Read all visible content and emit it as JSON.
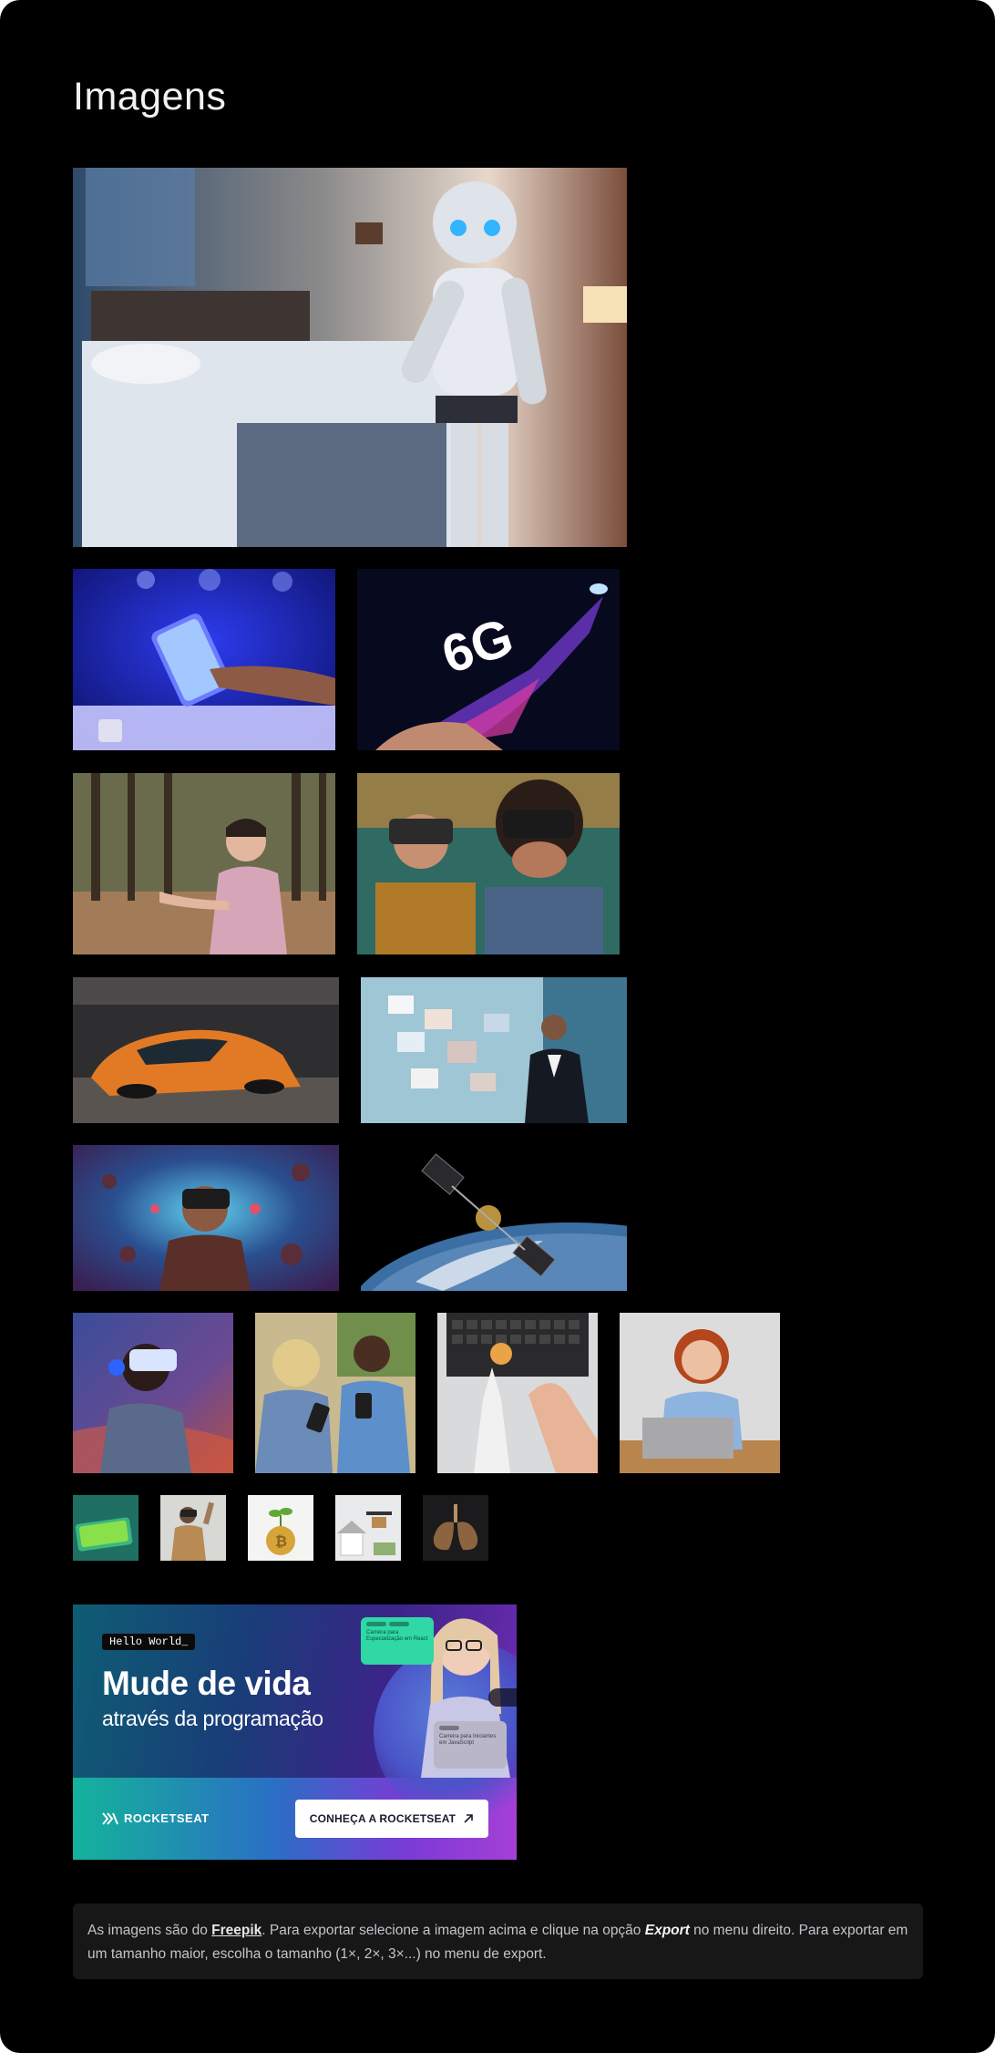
{
  "page": {
    "title": "Imagens",
    "background_color": "#000000"
  },
  "images": [
    {
      "icon": "robot-hotel-room-image"
    },
    {
      "icon": "smartphone-hologram-image"
    },
    {
      "icon": "6g-rocket-phone-image"
    },
    {
      "icon": "woman-smartwatch-forest-image"
    },
    {
      "icon": "kids-vr-headsets-image"
    },
    {
      "icon": "orange-futuristic-car-image"
    },
    {
      "icon": "man-holographic-screens-image"
    },
    {
      "icon": "man-vr-space-image"
    },
    {
      "icon": "satellite-earth-image"
    },
    {
      "icon": "woman-vr-galaxy-image"
    },
    {
      "icon": "people-phones-image"
    },
    {
      "icon": "robot-hand-laptop-image"
    },
    {
      "icon": "woman-phone-laptop-image"
    },
    {
      "icon": "green-phone-thumbnail"
    },
    {
      "icon": "vr-man-thumbnail"
    },
    {
      "icon": "bitcoin-plant-thumbnail"
    },
    {
      "icon": "drone-house-thumbnail"
    },
    {
      "icon": "lungs-thumbnail"
    }
  ],
  "banner": {
    "hello": "Hello World_",
    "headline": "Mude de vida",
    "subheadline": "através da programação",
    "card_green_text": "Carreira para Especialização em React",
    "card_gray_text": "Carreira para Iniciantes em JavaScript",
    "logo": "ROCKETSEAT",
    "cta": "CONHEÇA A ROCKETSEAT"
  },
  "note": {
    "part1": "As imagens são do ",
    "link": "Freepik",
    "part2": ". Para exportar selecione a imagem acima e clique na opção ",
    "export": "Export",
    "part3": " no menu direito. Para exportar em um tamanho maior, escolha o tamanho (1×, 2×, 3×...) no menu de export."
  }
}
